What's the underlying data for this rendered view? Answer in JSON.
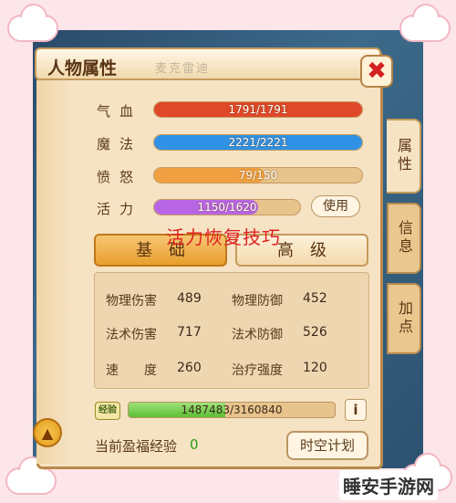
{
  "window": {
    "title": "人物属性",
    "title_deco": "麦克雷迪"
  },
  "stats": [
    {
      "label": "气血",
      "text": "1791/1791",
      "fraction": 1.0,
      "color": "#e0482a"
    },
    {
      "label": "魔法",
      "text": "2221/2221",
      "fraction": 1.0,
      "color": "#2f92e6"
    },
    {
      "label": "愤怒",
      "text": "79/150",
      "fraction": 0.53,
      "color": "#f0a040"
    },
    {
      "label": "活力",
      "text": "1150/1620",
      "fraction": 0.71,
      "color": "#b866e6"
    }
  ],
  "use_button": "使用",
  "overlay_text": "活力恢复技巧",
  "tabs": {
    "basic": "基础",
    "advanced": "高级"
  },
  "attributes": [
    {
      "label": "物理伤害",
      "value": "489"
    },
    {
      "label": "物理防御",
      "value": "452"
    },
    {
      "label": "法术伤害",
      "value": "717"
    },
    {
      "label": "法术防御",
      "value": "526"
    },
    {
      "label": "速　　度",
      "value": "260"
    },
    {
      "label": "治疗强度",
      "value": "120"
    }
  ],
  "exp": {
    "badge": "经验",
    "text": "1487483/3160840",
    "fraction": 0.47
  },
  "info_button": "i",
  "bless": {
    "label": "当前盈福经验",
    "value": "0"
  },
  "plan_button": "时空计划",
  "side_tabs": {
    "attr": "属性",
    "info": "信息",
    "add": "加点"
  },
  "watermark": "睡安手游网",
  "close_icon": "close-icon"
}
